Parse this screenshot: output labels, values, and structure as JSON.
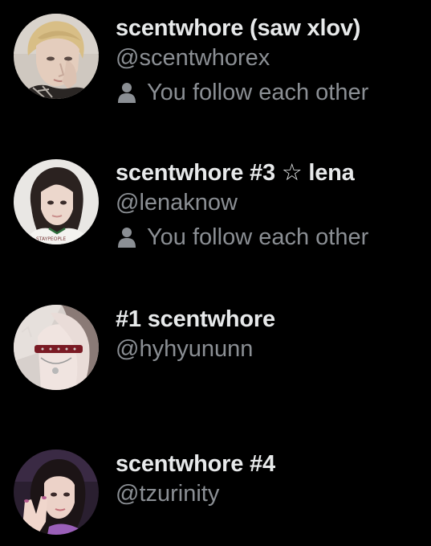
{
  "users": [
    {
      "display_name": "scentwhore (saw xlov)",
      "handle": "@scentwhorex",
      "follow_status": "You follow each other",
      "avatar_icon": "avatar-photo-blonde-person",
      "follows_each_other": true
    },
    {
      "display_name": "scentwhore #3 ☆ lena",
      "handle": "@lenaknow",
      "follow_status": "You follow each other",
      "avatar_icon": "avatar-photo-dark-hair-person",
      "follows_each_other": true
    },
    {
      "display_name": "#1 scentwhore",
      "handle": "@hyhyununn",
      "avatar_icon": "avatar-photo-choker-person",
      "follows_each_other": false
    },
    {
      "display_name": "scentwhore #4",
      "handle": "@tzurinity",
      "avatar_icon": "avatar-photo-peace-sign-person",
      "follows_each_other": false
    }
  ],
  "colors": {
    "background": "#000000",
    "name_text": "#e7e9ea",
    "secondary_text": "#8b8f94"
  }
}
